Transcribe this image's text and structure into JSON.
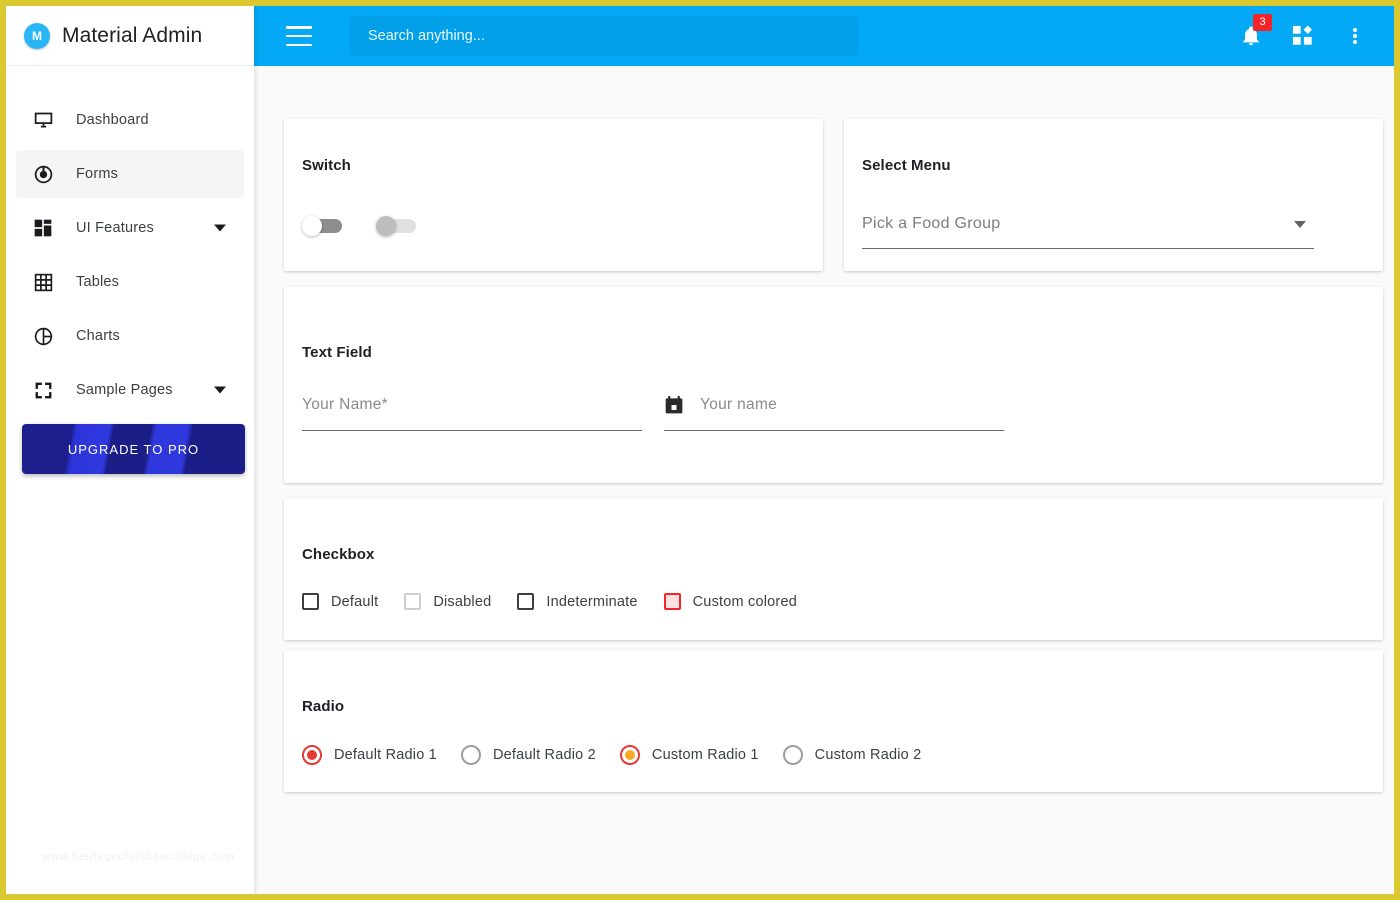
{
  "brand": {
    "logo_letter": "M",
    "title": "Material Admin"
  },
  "sidebar": {
    "items": [
      {
        "label": "Dashboard",
        "icon": "monitor-icon",
        "active": false,
        "has_caret": false
      },
      {
        "label": "Forms",
        "icon": "spiral-icon",
        "active": true,
        "has_caret": false
      },
      {
        "label": "UI Features",
        "icon": "dashboard-icon",
        "active": false,
        "has_caret": true
      },
      {
        "label": "Tables",
        "icon": "grid-icon",
        "active": false,
        "has_caret": false
      },
      {
        "label": "Charts",
        "icon": "pie-chart-icon",
        "active": false,
        "has_caret": false
      },
      {
        "label": "Sample Pages",
        "icon": "expand-icon",
        "active": false,
        "has_caret": true
      }
    ],
    "upgrade_label": "UPGRADE TO PRO"
  },
  "watermark": "www.heritagechristiancollege.com",
  "topbar": {
    "menu_icon": "hamburger-icon",
    "search_placeholder": "Search anything...",
    "search_value": "",
    "notification_count": "3",
    "apps_icon": "apps-grid-icon",
    "more_icon": "kebab-menu-icon",
    "accent_color": "#03a9f4"
  },
  "cards": {
    "switch": {
      "title": "Switch",
      "switches": [
        {
          "name": "default-switch",
          "checked": false,
          "disabled": false
        },
        {
          "name": "disabled-switch",
          "checked": false,
          "disabled": true
        }
      ]
    },
    "select": {
      "title": "Select Menu",
      "placeholder": "Pick a Food Group",
      "value": "",
      "caret_icon": "chevron-down-icon"
    },
    "textfield": {
      "title": "Text Field",
      "fields": [
        {
          "name": "your-name-input",
          "placeholder": "Your Name*",
          "value": "",
          "icon": null
        },
        {
          "name": "date-input",
          "placeholder": "Your name",
          "value": "",
          "icon": "calendar-icon"
        }
      ]
    },
    "checkbox": {
      "title": "Checkbox",
      "items": [
        {
          "label": "Default",
          "state": "default"
        },
        {
          "label": "Disabled",
          "state": "disabled"
        },
        {
          "label": "Indeterminate",
          "state": "indeterminate"
        },
        {
          "label": "Custom colored",
          "state": "custom"
        }
      ],
      "custom_color": "#f4252a"
    },
    "radio": {
      "title": "Radio",
      "items": [
        {
          "label": "Default Radio 1",
          "selected": true,
          "style": "red"
        },
        {
          "label": "Default Radio 2",
          "selected": false,
          "style": "plain"
        },
        {
          "label": "Custom Radio 1",
          "selected": true,
          "style": "amber"
        },
        {
          "label": "Custom Radio 2",
          "selected": false,
          "style": "plain"
        }
      ],
      "selected_color": "#e53935",
      "custom_color": "#f9a825"
    }
  }
}
